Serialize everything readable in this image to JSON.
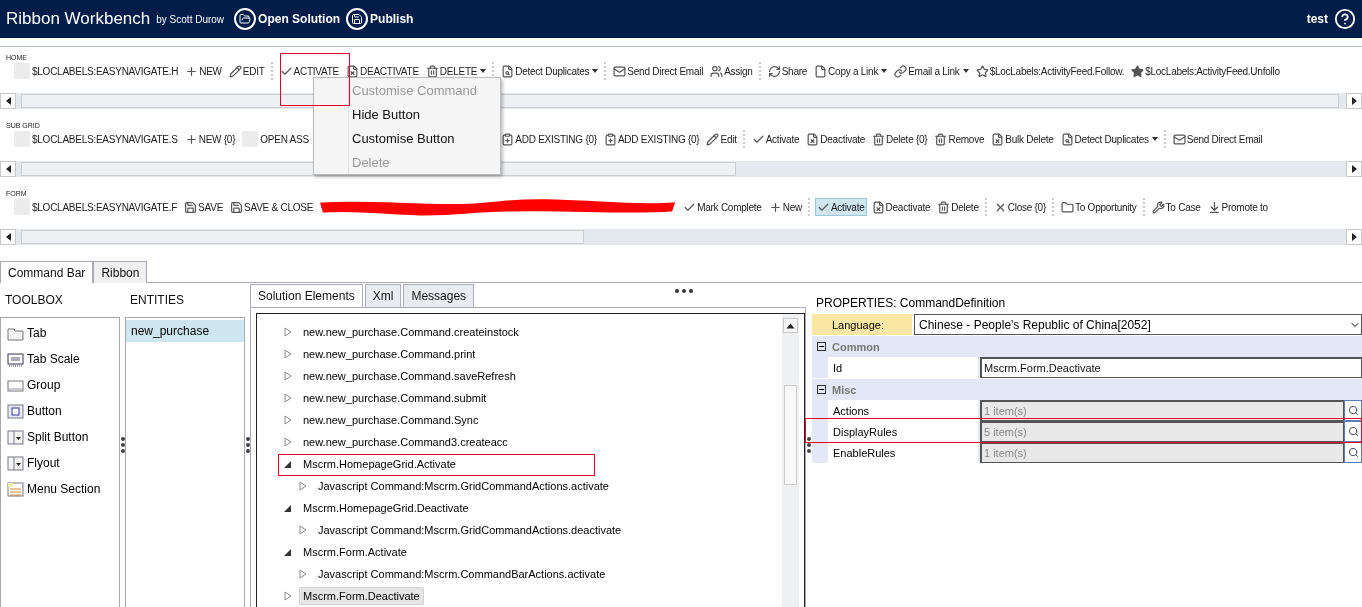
{
  "header": {
    "title": "Ribbon Workbench",
    "byline": "by Scott Durow",
    "actions": [
      {
        "label": "Open Solution",
        "kind": "open"
      },
      {
        "label": "Publish",
        "kind": "save"
      }
    ],
    "user": "test"
  },
  "ribbon": [
    {
      "title": "HOME",
      "groups": [
        [
          {
            "label": "$LOCLABELS:EASYNAVIGATE.H",
            "kind": "blank",
            "dropdown": false,
            "selected": false
          },
          {
            "label": "NEW",
            "kind": "plus",
            "dropdown": false,
            "selected": false
          },
          {
            "label": "EDIT",
            "kind": "pencil",
            "dropdown": false,
            "selected": false
          }
        ],
        [
          {
            "label": "ACTIVATE",
            "kind": "check",
            "dropdown": false,
            "selected": false
          },
          {
            "label": "DEACTIVATE",
            "kind": "deactivate",
            "dropdown": false,
            "selected": false
          },
          {
            "label": "DELETE",
            "kind": "trash",
            "dropdown": true,
            "selected": false
          }
        ],
        [
          {
            "label": "Detect Duplicates",
            "kind": "duplicates",
            "dropdown": true,
            "selected": false
          }
        ],
        [
          {
            "label": "Send Direct Email",
            "kind": "mail",
            "dropdown": false,
            "selected": false
          },
          {
            "label": "Assign",
            "kind": "assign",
            "dropdown": false,
            "selected": false
          }
        ],
        [
          {
            "label": "Share",
            "kind": "share",
            "dropdown": false,
            "selected": false
          },
          {
            "label": "Copy a Link",
            "kind": "page",
            "dropdown": true,
            "selected": false
          },
          {
            "label": "Email a Link",
            "kind": "link",
            "dropdown": true,
            "selected": false
          },
          {
            "label": "$LocLabels:ActivityFeed.Follow.",
            "kind": "star-outline",
            "dropdown": false,
            "selected": false
          },
          {
            "label": "$LocLabels:ActivityFeed.Unfollo",
            "kind": "star",
            "dropdown": false,
            "selected": false
          }
        ]
      ]
    },
    {
      "title": "SUB GRID",
      "groups": [
        [
          {
            "label": "$LOCLABELS:EASYNAVIGATE.S",
            "kind": "blank",
            "dropdown": false,
            "selected": false
          },
          {
            "label": "NEW {0}",
            "kind": "plus",
            "dropdown": false,
            "selected": false
          },
          {
            "label": "OPEN ASS",
            "kind": "covered",
            "dropdown": false,
            "selected": false
          },
          {
            "label": "ADD EXISTING {0}",
            "kind": "add-existing",
            "dropdown": false,
            "selected": false
          },
          {
            "label": "ADD EXISTING {0}",
            "kind": "add-existing",
            "dropdown": false,
            "selected": false
          },
          {
            "label": "Edit",
            "kind": "pencil",
            "dropdown": false,
            "selected": false
          }
        ],
        [
          {
            "label": "Activate",
            "kind": "check",
            "dropdown": false,
            "selected": false
          },
          {
            "label": "Deactivate",
            "kind": "deactivate",
            "dropdown": false,
            "selected": false
          },
          {
            "label": "Delete {0}",
            "kind": "trash",
            "dropdown": false,
            "selected": false
          },
          {
            "label": "Remove",
            "kind": "trash",
            "dropdown": false,
            "selected": false
          },
          {
            "label": "Bulk Delete",
            "kind": "bulk-delete",
            "dropdown": false,
            "selected": false
          },
          {
            "label": "Detect Duplicates",
            "kind": "duplicates",
            "dropdown": true,
            "selected": false
          }
        ],
        [
          {
            "label": "Send Direct Email",
            "kind": "mail",
            "dropdown": false,
            "selected": false
          }
        ]
      ]
    },
    {
      "title": "FORM",
      "groups": [
        [
          {
            "label": "$LOCLABELS:EASYNAVIGATE.F",
            "kind": "blank",
            "dropdown": false,
            "selected": false
          },
          {
            "label": "SAVE",
            "kind": "save",
            "dropdown": false,
            "selected": false
          },
          {
            "label": "SAVE & CLOSE",
            "kind": "save-close",
            "dropdown": false,
            "selected": false
          },
          {
            "kind": "redacted"
          },
          {
            "label": "Mark Complete",
            "kind": "check",
            "dropdown": false,
            "selected": false
          },
          {
            "label": "New",
            "kind": "plus",
            "dropdown": false,
            "selected": false
          }
        ],
        [
          {
            "label": "Activate",
            "kind": "check",
            "dropdown": false,
            "selected": true
          },
          {
            "label": "Deactivate",
            "kind": "deactivate",
            "dropdown": false,
            "selected": false
          },
          {
            "label": "Delete",
            "kind": "trash",
            "dropdown": false,
            "selected": false
          }
        ],
        [
          {
            "label": "Close {0}",
            "kind": "close",
            "dropdown": false,
            "selected": false
          }
        ],
        [
          {
            "label": "To Opportunity",
            "kind": "folder",
            "dropdown": false,
            "selected": false
          }
        ],
        [
          {
            "label": "To Case",
            "kind": "wrench",
            "dropdown": false,
            "selected": false
          },
          {
            "label": "Promote to",
            "kind": "promote",
            "dropdown": false,
            "selected": false
          }
        ]
      ]
    }
  ],
  "context_menu": [
    {
      "label": "Customise Command",
      "disabled": true
    },
    {
      "label": "Hide Button",
      "disabled": false
    },
    {
      "label": "Customise Button",
      "disabled": false
    },
    {
      "label": "Delete",
      "disabled": true
    }
  ],
  "view_tabs": [
    {
      "label": "Command Bar",
      "selected": true
    },
    {
      "label": "Ribbon",
      "selected": false
    }
  ],
  "toolbox": {
    "title": "TOOLBOX",
    "items": [
      {
        "label": "Tab",
        "kind": "tab"
      },
      {
        "label": "Tab Scale",
        "kind": "scale"
      },
      {
        "label": "Group",
        "kind": "group"
      },
      {
        "label": "Button",
        "kind": "button"
      },
      {
        "label": "Split Button",
        "kind": "split"
      },
      {
        "label": "Flyout",
        "kind": "split"
      },
      {
        "label": "Menu Section",
        "kind": "menu"
      }
    ]
  },
  "entities": {
    "title": "ENTITIES",
    "items": [
      {
        "label": "new_purchase",
        "selected": true
      }
    ]
  },
  "solution": {
    "tabs": [
      {
        "label": "Solution Elements",
        "selected": true
      },
      {
        "label": "Xml",
        "selected": false
      },
      {
        "label": "Messages",
        "selected": false
      }
    ],
    "tree": [
      {
        "label": "new.new_purchase.Command.createinstock",
        "expanded": false,
        "selected": false
      },
      {
        "label": "new.new_purchase.Command.print",
        "expanded": false,
        "selected": false
      },
      {
        "label": "new.new_purchase.Command.saveRefresh",
        "expanded": false,
        "selected": false
      },
      {
        "label": "new.new_purchase.Command.submit",
        "expanded": false,
        "selected": false
      },
      {
        "label": "new.new_purchase.Command.Sync",
        "expanded": false,
        "selected": false
      },
      {
        "label": "new.new_purchase.Command3.createacc",
        "expanded": false,
        "selected": false
      },
      {
        "label": "Mscrm.HomepageGrid.Activate",
        "expanded": true,
        "selected": false,
        "children": [
          {
            "label": "Javascript Command:Mscrm.GridCommandActions.activate",
            "expanded": false,
            "selected": false
          }
        ]
      },
      {
        "label": "Mscrm.HomepageGrid.Deactivate",
        "expanded": true,
        "selected": false,
        "children": [
          {
            "label": "Javascript Command:Mscrm.GridCommandActions.deactivate",
            "expanded": false,
            "selected": false
          }
        ]
      },
      {
        "label": "Mscrm.Form.Activate",
        "expanded": true,
        "selected": false,
        "children": [
          {
            "label": "Javascript Command:Mscrm.CommandBarActions.activate",
            "expanded": false,
            "selected": false
          }
        ]
      },
      {
        "label": "Mscrm.Form.Deactivate",
        "expanded": false,
        "selected": true
      }
    ]
  },
  "properties": {
    "title": "PROPERTIES: CommandDefinition",
    "language_label": "Language:",
    "language": "Chinese - People's Republic of China[2052]",
    "categories": [
      {
        "name": "Common",
        "expanded": true,
        "rows": [
          {
            "name": "Id",
            "value": "Mscrm.Form.Deactivate",
            "kind": "text"
          }
        ]
      },
      {
        "name": "Misc",
        "expanded": true,
        "rows": [
          {
            "name": "Actions",
            "value": "1 item(s)",
            "kind": "collection"
          },
          {
            "name": "DisplayRules",
            "value": "5 item(s)",
            "kind": "collection"
          },
          {
            "name": "EnableRules",
            "value": "1 item(s)",
            "kind": "collection"
          }
        ]
      }
    ]
  }
}
